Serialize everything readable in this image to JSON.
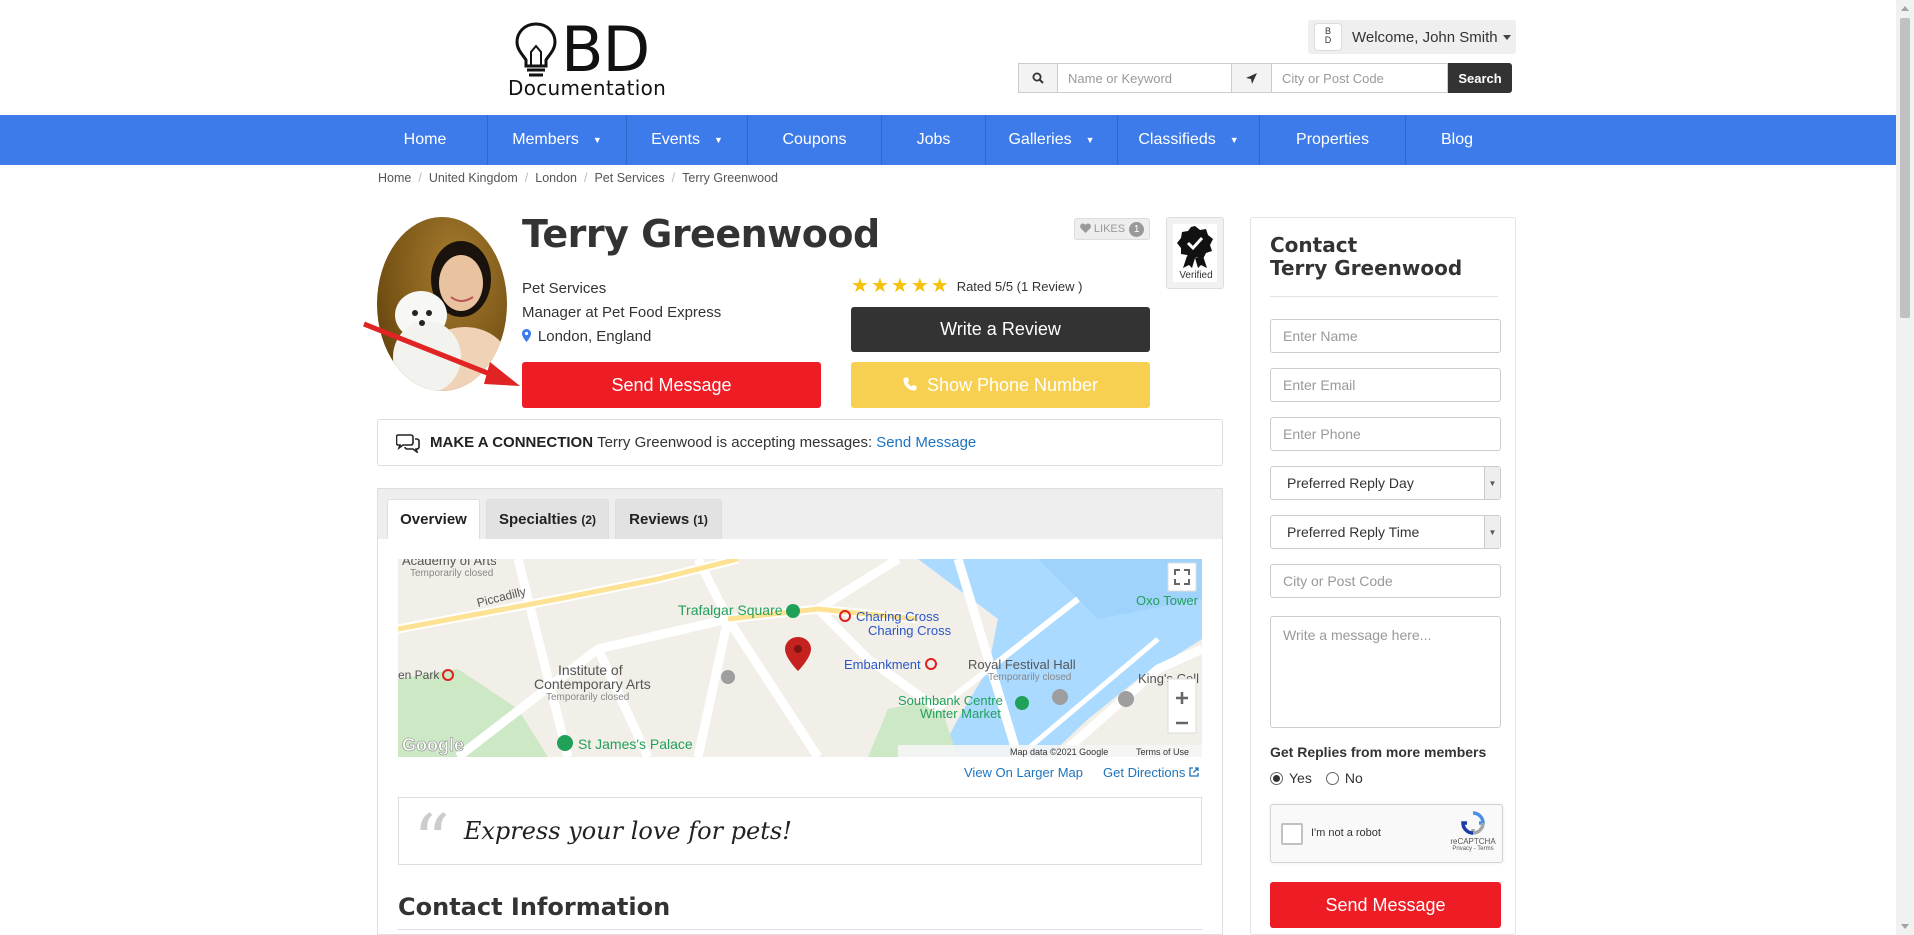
{
  "brand": {
    "logo_main": "BD",
    "logo_sub": "Documentation"
  },
  "header": {
    "welcome_text": "Welcome, John Smith",
    "keyword_placeholder": "Name or Keyword",
    "location_placeholder": "City or Post Code",
    "search_label": "Search"
  },
  "nav": {
    "items": [
      {
        "label": "Home"
      },
      {
        "label": "Members",
        "arrow": "▼"
      },
      {
        "label": "Events",
        "arrow": "▼"
      },
      {
        "label": "Coupons"
      },
      {
        "label": "Jobs"
      },
      {
        "label": "Galleries",
        "arrow": "▼"
      },
      {
        "label": "Classifieds",
        "arrow": "▼"
      },
      {
        "label": "Properties"
      },
      {
        "label": "Blog"
      }
    ]
  },
  "breadcrumb": [
    "Home",
    "United Kingdom",
    "London",
    "Pet Services",
    "Terry Greenwood"
  ],
  "profile": {
    "name": "Terry Greenwood",
    "category": "Pet Services",
    "position": "Manager at Pet Food Express",
    "location": "London, England",
    "likes_label": "LIKES",
    "likes_count": "1",
    "verified_label": "Verified",
    "rating_text": "Rated 5/5 (1 Review )",
    "rating_stars": 5,
    "write_review": "Write a Review",
    "send_message": "Send Message",
    "show_phone": "Show Phone Number"
  },
  "connection": {
    "heading": "MAKE A CONNECTION",
    "text": "Terry Greenwood is accepting messages:",
    "link": "Send Message"
  },
  "tabs": [
    {
      "label": "Overview",
      "count": ""
    },
    {
      "label": "Specialties",
      "count": "(2)"
    },
    {
      "label": "Reviews",
      "count": "(1)"
    }
  ],
  "map": {
    "labels": {
      "academy": "Academy of Arts",
      "academy_sub": "Temporarily closed",
      "piccadilly": "Piccadilly",
      "trafalgar": "Trafalgar Square",
      "charing1": "Charing Cross",
      "charing2": "Charing Cross",
      "embankment": "Embankment",
      "festival": "Royal Festival Hall",
      "festival_sub": "Temporarily closed",
      "oxo": "Oxo Tower",
      "ica1": "Institute of",
      "ica2": "Contemporary Arts",
      "ica_sub": "Temporarily closed",
      "southbank1": "Southbank Centre",
      "southbank2": "Winter Market",
      "kings": "King's Coll",
      "park": "en Park",
      "stjames": "St James's Palace",
      "google": "Google",
      "mapdata": "Map data ©2021 Google",
      "terms": "Terms of Use"
    },
    "larger_map": "View On Larger Map",
    "directions": "Get Directions"
  },
  "quote": "Express your love for pets!",
  "contact_info_title": "Contact Information",
  "contact_form": {
    "title_line1": "Contact",
    "title_line2": "Terry Greenwood",
    "name_placeholder": "Enter Name",
    "email_placeholder": "Enter Email",
    "phone_placeholder": "Enter Phone",
    "reply_day": "Preferred Reply Day",
    "reply_time": "Preferred Reply Time",
    "city_placeholder": "City or Post Code",
    "message_placeholder": "Write a message here...",
    "replies_label": "Get Replies from more members",
    "yes": "Yes",
    "no": "No",
    "captcha_text": "I'm not a robot",
    "captcha_brand": "reCAPTCHA",
    "captcha_links": "Privacy - Terms",
    "send": "Send Message"
  },
  "colors": {
    "nav_blue": "#3d7bea",
    "send_red": "#ee1c24",
    "phone_yellow": "#f8d051",
    "review_dark": "#333333",
    "star_gold": "#f4c20d",
    "link_blue": "#1e73be"
  }
}
